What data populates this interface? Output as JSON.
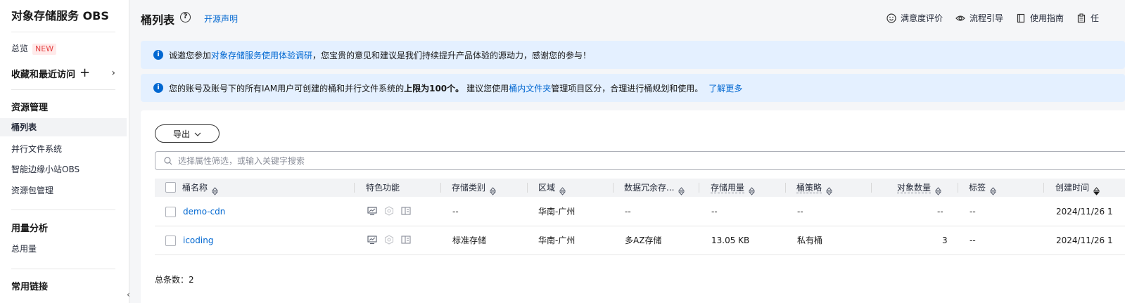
{
  "sidebar": {
    "title": "对象存储服务 OBS",
    "overview": "总览",
    "overview_badge": "NEW",
    "favorites": "收藏和最近访问",
    "resource_group": "资源管理",
    "items": [
      "桶列表",
      "并行文件系统",
      "智能边缘小站OBS",
      "资源包管理"
    ],
    "usage_group": "用量分析",
    "usage_items": [
      "总用量"
    ],
    "links_group": "常用链接"
  },
  "header": {
    "title": "桶列表",
    "open_source_link": "开源声明",
    "actions": [
      {
        "label": "满意度评价",
        "icon": "smile-icon"
      },
      {
        "label": "流程引导",
        "icon": "eye-icon"
      },
      {
        "label": "使用指南",
        "icon": "book-icon"
      },
      {
        "label": "任",
        "icon": "clipboard-icon"
      }
    ]
  },
  "notices": {
    "survey_prefix": "诚邀您参加",
    "survey_link": "对象存储服务使用体验调研",
    "survey_suffix": "，您宝贵的意见和建议是我们持续提升产品体验的源动力，感谢您的参与！",
    "limit_prefix": "您的账号及账号下的所有IAM用户可创建的桶和并行文件系统的",
    "limit_bold": "上限为100个。",
    "limit_mid": "建议您使用",
    "limit_link": "桶内文件夹",
    "limit_suffix": "管理项目区分，合理进行桶规划和使用。",
    "learn_more": "了解更多"
  },
  "toolbar": {
    "export_label": "导出",
    "search_placeholder": "选择属性筛选，或输入关键字搜索"
  },
  "table": {
    "columns": [
      "桶名称",
      "特色功能",
      "存储类别",
      "区域",
      "数据冗余存...",
      "存储用量",
      "桶策略",
      "对象数量",
      "标签",
      "创建时间"
    ],
    "rows": [
      {
        "name": "demo-cdn",
        "storage_class": "--",
        "region": "华南-广州",
        "redundancy": "--",
        "usage": "--",
        "policy": "--",
        "objects": "--",
        "tags": "--",
        "created": "2024/11/26 1"
      },
      {
        "name": "icoding",
        "storage_class": "标准存储",
        "region": "华南-广州",
        "redundancy": "多AZ存储",
        "usage": "13.05 KB",
        "policy": "私有桶",
        "objects": "3",
        "tags": "--",
        "created": "2024/11/26 1"
      }
    ],
    "total_label": "总条数：",
    "total_value": "2"
  }
}
